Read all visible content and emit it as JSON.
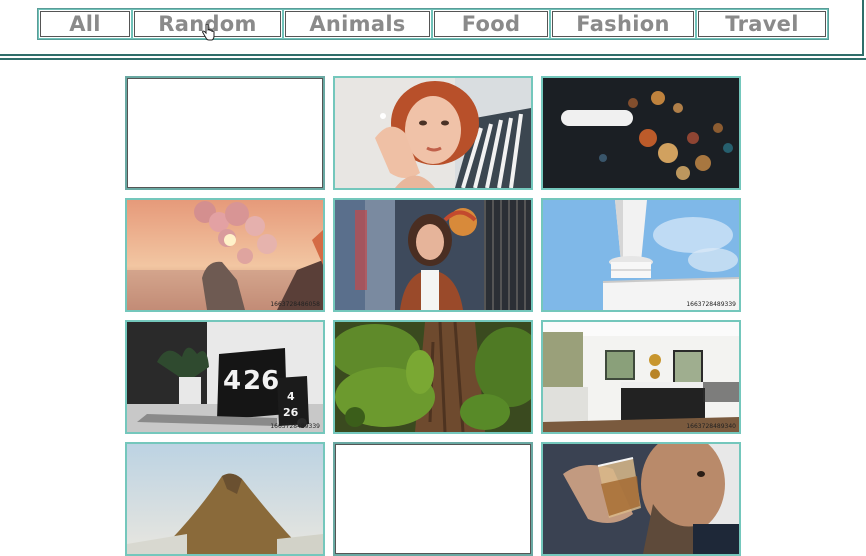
{
  "filter_tabs": [
    {
      "label": "All"
    },
    {
      "label": "Random"
    },
    {
      "label": "Animals"
    },
    {
      "label": "Food"
    },
    {
      "label": "Fashion"
    },
    {
      "label": "Travel"
    }
  ],
  "gallery": {
    "image_ids": {
      "balloons": "1663728486058",
      "tower": "1663728489339",
      "clock": "1663728489339",
      "kitchen": "1663728489340"
    },
    "clock_display": {
      "hour": "4",
      "minute": "26",
      "small_top": "4",
      "small_bottom": "26"
    }
  },
  "colors": {
    "tab_text": "#8a8a8a",
    "tile_border": "#74c7bc",
    "bar_border": "#2f6e6a"
  }
}
